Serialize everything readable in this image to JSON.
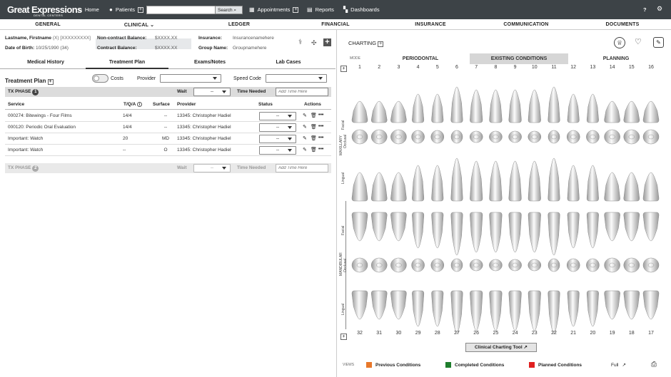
{
  "header": {
    "logo": "Great Expressions",
    "logo_sub": "DENTAL CENTERS",
    "home": "Home",
    "patients": "Patients",
    "search_label": "Search",
    "search_value": "",
    "appointments": "Appointments",
    "reports": "Reports",
    "dashboards": "Dashboards",
    "help": "?",
    "settings": "⚙"
  },
  "nav": [
    "GENERAL",
    "CLINICAL",
    "LEDGER",
    "FINANCIAL",
    "INSURANCE",
    "COMMUNICATION",
    "DOCUMENTS"
  ],
  "patient": {
    "name_label": "Lastname, Firstname",
    "name_extra": "(X) [XXXXXXXXX]",
    "dob_label": "Date of Birth:",
    "dob": "10/25/1990 (34)",
    "noncontract_label": "Non-contract Balance:",
    "noncontract": "$XXXX.XX",
    "contract_label": "Contract Balance:",
    "contract": "$XXXX.XX",
    "insurance_label": "Insurance:",
    "insurance": "Insurancenamehere",
    "group_label": "Group Name:",
    "group": "Groupnamehere"
  },
  "tabs": [
    "Medical History",
    "Treatment Plan",
    "Exams/Notes",
    "Lab Cases"
  ],
  "plan": {
    "title": "Treatment Plan",
    "costs": "Costs",
    "provider": "Provider",
    "speed_code": "Speed Code",
    "phase1": "TX PHASE",
    "phase1_num": "1",
    "phase2": "TX PHASE",
    "phase2_num": "2",
    "wait": "Wait",
    "wait_value": "--",
    "time_needed": "Time Needed",
    "time_placeholder": "Add Time Here",
    "headers": {
      "service": "Service",
      "tqa": "T/Q/A",
      "surface": "Surface",
      "provider": "Provider",
      "status": "Status",
      "actions": "Actions"
    },
    "rows": [
      {
        "service": "000274: Bitewings - Four Films",
        "tqa": "14/4",
        "surface": "--",
        "provider": "13345: Christopher Hadiel",
        "status": "--"
      },
      {
        "service": "000120: Periodic Oral Evaluation",
        "tqa": "14/4",
        "surface": "--",
        "provider": "13345: Christopher Hadiel",
        "status": "--"
      },
      {
        "service": "Important: Watch",
        "tqa": "20",
        "surface": "MD",
        "provider": "13345: Christopher Hadiel",
        "status": "--"
      },
      {
        "service": "Important: Watch",
        "tqa": "--",
        "surface": "O",
        "provider": "13345: Christopher Hadiel",
        "status": "--"
      }
    ]
  },
  "charting": {
    "title": "CHARTING",
    "mode_label": "MODE",
    "modes": [
      "PERIODONTAL",
      "EXISTING CONDITIONS",
      "PLANNING"
    ],
    "upper_numbers": [
      "1",
      "2",
      "3",
      "4",
      "5",
      "6",
      "7",
      "8",
      "9",
      "10",
      "11",
      "12",
      "13",
      "14",
      "15",
      "16"
    ],
    "lower_numbers": [
      "32",
      "31",
      "30",
      "29",
      "28",
      "27",
      "26",
      "25",
      "24",
      "23",
      "22",
      "21",
      "20",
      "19",
      "18",
      "17"
    ],
    "side_labels": {
      "facial": "Facial",
      "maxillary": "MAXILLARY",
      "occlusal": "Occlusal",
      "lingual": "Lingual",
      "mandibular": "MANDIBULAR"
    },
    "tool_button": "Clinical Charting Tool",
    "views_label": "VIEWS",
    "legend": [
      {
        "label": "Previous Conditions",
        "color": "#e8782a"
      },
      {
        "label": "Completed Conditions",
        "color": "#1e7d2c"
      },
      {
        "label": "Planned Conditions",
        "color": "#e02020"
      }
    ],
    "full": "Full"
  }
}
